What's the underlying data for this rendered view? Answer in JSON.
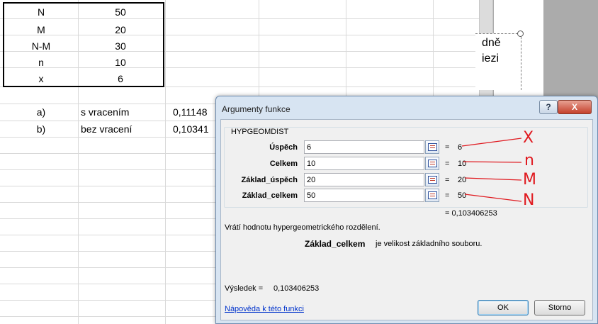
{
  "sheet": {
    "table": [
      {
        "label": "N",
        "value": "50"
      },
      {
        "label": "M",
        "value": "20"
      },
      {
        "label": "N-M",
        "value": "30"
      },
      {
        "label": "n",
        "value": "10"
      },
      {
        "label": "x",
        "value": "6"
      }
    ],
    "results": [
      {
        "label": "a)",
        "desc": "s vracením",
        "value": "0,11148"
      },
      {
        "label": "b)",
        "desc": "bez vracení",
        "value": "0,10341"
      }
    ]
  },
  "document": {
    "text_line1": "dně",
    "text_line2": "iezi"
  },
  "dialog": {
    "title": "Argumenty funkce",
    "help_button": "?",
    "close_button": "X",
    "function_name": "HYPGEOMDIST",
    "args": [
      {
        "label": "Úspěch",
        "value": "6",
        "result": "6"
      },
      {
        "label": "Celkem",
        "value": "10",
        "result": "10"
      },
      {
        "label": "Základ_úspěch",
        "value": "20",
        "result": "20"
      },
      {
        "label": "Základ_celkem",
        "value": "50",
        "result": "50"
      }
    ],
    "equals": "=",
    "formula_result": "= 0,103406253",
    "description": "Vrátí hodnotu hypergeometrického rozdělení.",
    "arg_desc_name": "Základ_celkem",
    "arg_desc_text": "je velikost základního souboru.",
    "result_label": "Výsledek =",
    "result_value": "0,103406253",
    "help_link": "Nápověda k této funkci",
    "ok_button": "OK",
    "cancel_button": "Storno"
  },
  "annotations": {
    "x": "X",
    "n": "n",
    "M": "M",
    "N": "N",
    "color": "#e0191f"
  }
}
